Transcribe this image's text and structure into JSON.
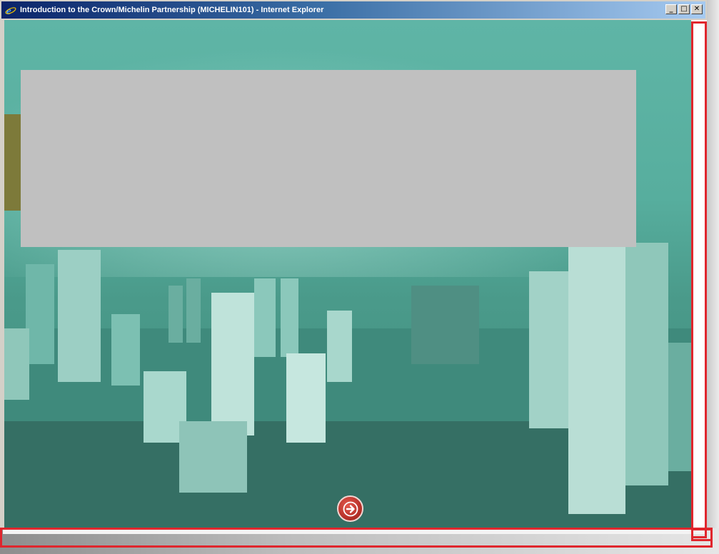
{
  "window": {
    "title": "Introduction to the Crown/Michelin Partnership (MICHELIN101) - Internet Explorer",
    "controls": {
      "minimize": "_",
      "maximize": "□",
      "close": "✕"
    }
  },
  "colors": {
    "title_bar": "#0a246a",
    "content_tint": "#57ae9e",
    "gray_panel": "#c0c0c0",
    "olive_strip": "#7d7a3a",
    "next_button": "#b8322a",
    "highlight": "#e0262d"
  },
  "icons": {
    "app_icon": "internet-explorer-icon",
    "next": "arrow-right-icon"
  }
}
